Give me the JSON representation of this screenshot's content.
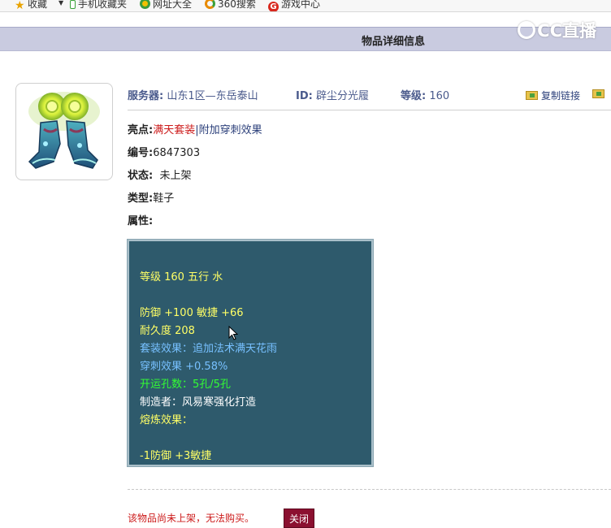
{
  "bookmarks": [
    {
      "label": "收藏",
      "icon": "star-icon"
    },
    {
      "label": "手机收藏夹",
      "icon": "phone-icon"
    },
    {
      "label": "网址大全",
      "icon": "globe-icon"
    },
    {
      "label": "360搜索",
      "icon": "search-ring-icon"
    },
    {
      "label": "游戏中心",
      "icon": "game-icon"
    }
  ],
  "page_title": "物品详细信息",
  "watermark": "CC直播",
  "header": {
    "server_label": "服务器:",
    "server_value": "山东1区—东岳泰山",
    "id_label": "ID:",
    "id_value": "辟尘分光履",
    "level_label": "等级:",
    "level_value": "160",
    "copy_link": "复制链接"
  },
  "details": {
    "highlight_label": "亮点:",
    "highlight_1": "满天套装",
    "highlight_sep": "|",
    "highlight_2": "附加穿刺效果",
    "number_label": "编号:",
    "number_value": "6847303",
    "status_label": "状态:",
    "status_value": "未上架",
    "type_label": "类型:",
    "type_value": "鞋子",
    "attr_label": "属性:"
  },
  "attributes": {
    "line1": "等级 160 五行 水",
    "line2": "防御 +100 敏捷 +66",
    "line3": "耐久度 208",
    "line4": "套装效果：追加法术满天花雨",
    "line5": "穿刺效果 +0.58%",
    "line6": "开运孔数：5孔/5孔",
    "line7": "制造者：风易寒强化打造",
    "line8": "熔炼效果：",
    "line9": "-1防御 +3敏捷"
  },
  "footer": {
    "notice": "该物品尚未上架，无法购买。",
    "close_button": "关闭"
  },
  "colors": {
    "title_bar": "#c9cbe0",
    "attr_bg": "#2e5a6c",
    "yellow": "#ffff66",
    "blue": "#77c0ff",
    "green": "#33ff33",
    "red": "#cc1a1a",
    "close_btn": "#8b1030"
  }
}
